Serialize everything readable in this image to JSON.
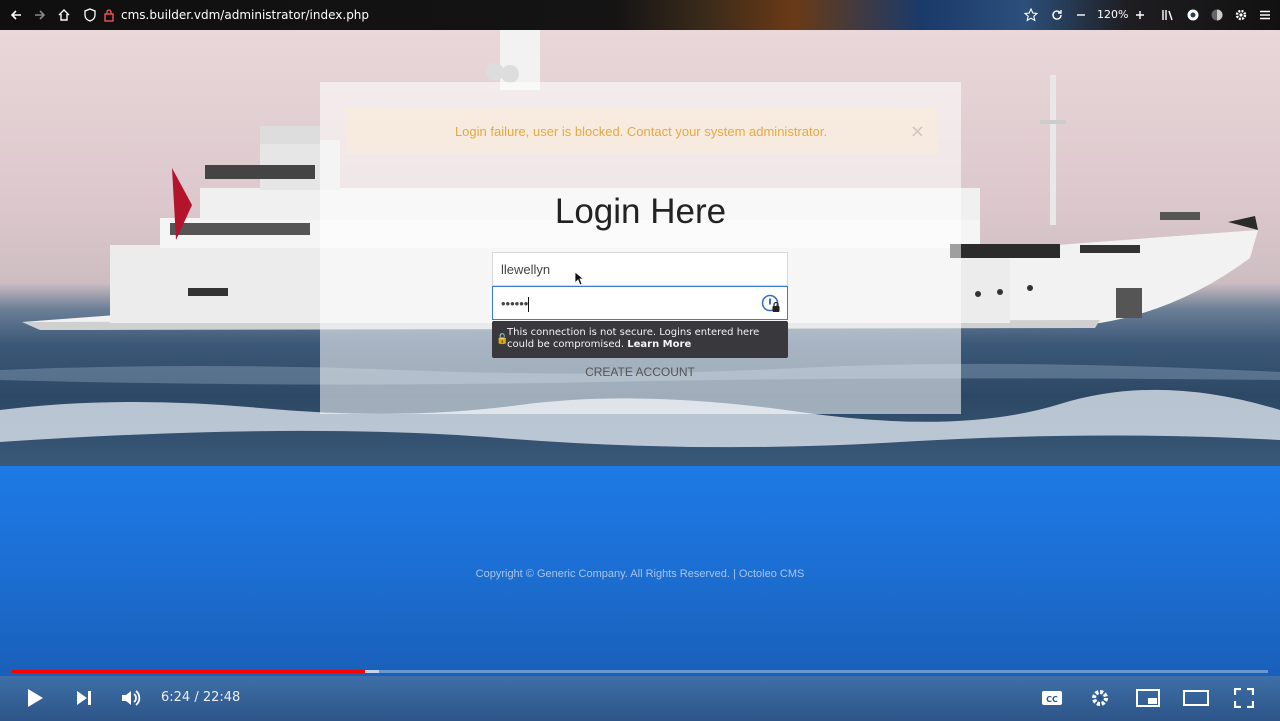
{
  "browser": {
    "url": "cms.builder.vdm/administrator/index.php",
    "zoom": "120%",
    "icons": [
      "back-icon",
      "forward-icon",
      "home-icon",
      "shield-icon",
      "lock-icon",
      "star-icon",
      "reload-icon",
      "zoom-out-icon",
      "zoom-in-icon",
      "library-icon",
      "extension-icon",
      "settings-icon",
      "menu-icon"
    ]
  },
  "login": {
    "alert_text": "Login failure, user is blocked. Contact your system administrator.",
    "alert_close": "×",
    "title": "Login Here",
    "username_value": "llewellyn",
    "password_value": "••••••",
    "insecure_warning": "This connection is not secure. Logins entered here could be compromised.",
    "learn_more": "Learn More",
    "create_account": "CREATE ACCOUNT"
  },
  "footer": {
    "copyright": "Copyright © Generic Company. All Rights Reserved. | Octoleo CMS"
  },
  "video": {
    "current_time": "6:24",
    "separator": " / ",
    "duration": "22:48",
    "played_fraction": 0.281,
    "buffered_fraction": 0.292,
    "colors": {
      "played": "#ff0000",
      "controls_text": "#eeeeee"
    }
  }
}
